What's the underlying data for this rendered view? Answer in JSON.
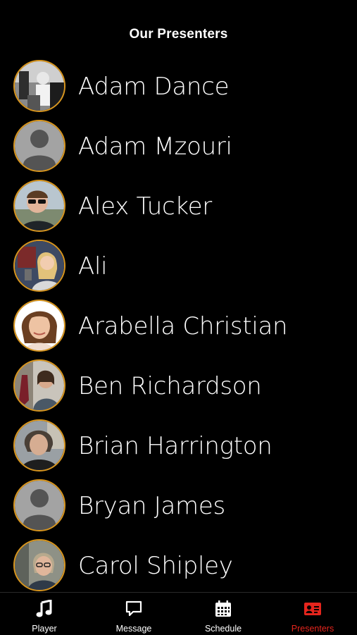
{
  "header": {
    "title": "Our Presenters"
  },
  "presenters": [
    {
      "name": "Adam Dance",
      "avatar": "photo"
    },
    {
      "name": "Adam Mzouri",
      "avatar": "placeholder"
    },
    {
      "name": "Alex Tucker",
      "avatar": "photo"
    },
    {
      "name": "Ali",
      "avatar": "photo"
    },
    {
      "name": "Arabella Christian",
      "avatar": "photo"
    },
    {
      "name": "Ben Richardson",
      "avatar": "photo"
    },
    {
      "name": "Brian Harrington",
      "avatar": "photo"
    },
    {
      "name": "Bryan James",
      "avatar": "placeholder"
    },
    {
      "name": "Carol Shipley",
      "avatar": "photo"
    }
  ],
  "tabbar": {
    "tabs": [
      {
        "label": "Player",
        "icon": "music-note-icon"
      },
      {
        "label": "Message",
        "icon": "speech-bubble-icon"
      },
      {
        "label": "Schedule",
        "icon": "calendar-icon"
      },
      {
        "label": "Presenters",
        "icon": "id-card-icon",
        "active": true
      }
    ]
  },
  "colors": {
    "accent": "#e5251d",
    "avatar_ring": "#d9961e",
    "background": "#000000"
  }
}
